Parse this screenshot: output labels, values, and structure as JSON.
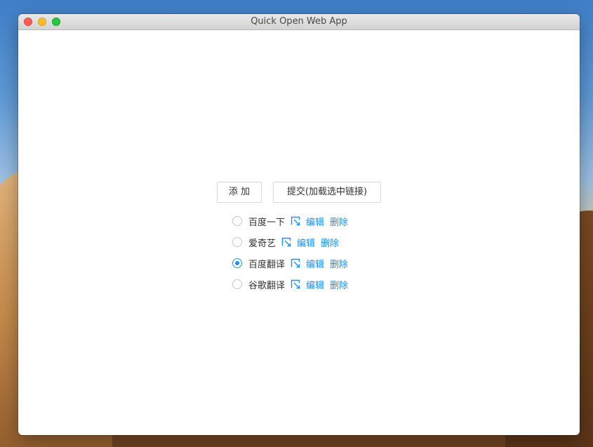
{
  "window": {
    "title": "Quick Open Web App"
  },
  "colors": {
    "accent": "#1890ff",
    "close": "#fc5f57",
    "minimize": "#fdbc2e",
    "maximize": "#28c840"
  },
  "toolbar": {
    "add_label": "添 加",
    "submit_label": "提交(加载选中链接)"
  },
  "items": [
    {
      "name": "百度一下",
      "edit": "编辑",
      "delete": "删除",
      "checked": false
    },
    {
      "name": "爱奇艺",
      "edit": "编辑",
      "delete": "删除",
      "checked": false
    },
    {
      "name": "百度翻译",
      "edit": "编辑",
      "delete": "删除",
      "checked": true
    },
    {
      "name": "谷歌翻译",
      "edit": "编辑",
      "delete": "删除",
      "checked": false
    }
  ],
  "icons": {
    "link": "external-link-icon"
  }
}
